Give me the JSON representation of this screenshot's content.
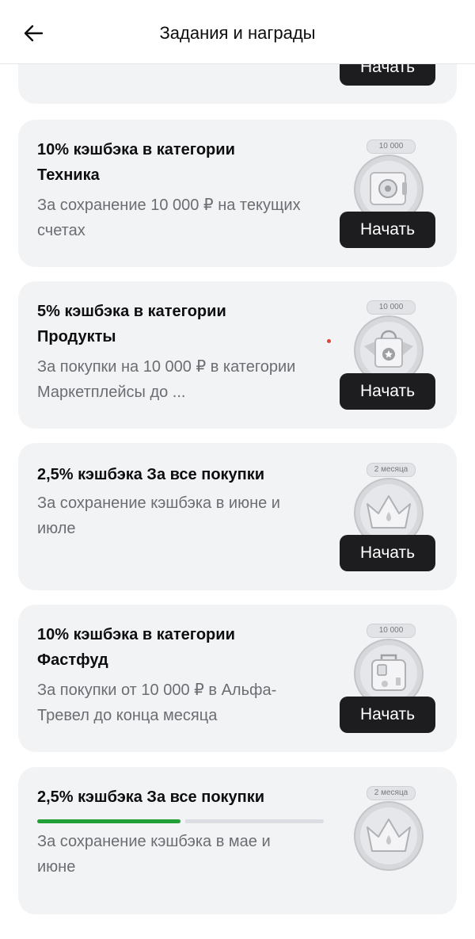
{
  "header": {
    "title": "Задания и награды",
    "back_icon": "arrow-left-icon"
  },
  "colors": {
    "card_bg": "#f2f3f5",
    "button_bg": "#1d1d20",
    "progress_fill": "#21a038",
    "progress_track": "#dcdde3",
    "secondary_text": "#6b6d72"
  },
  "top_partial_card": {
    "button_label": "Начать"
  },
  "tasks": [
    {
      "title": "10% кэшбэка в категории Техника",
      "description": "За сохранение 10 000 ₽ на текущих счетах",
      "badge": "10 000",
      "medal_icon": "safe-icon",
      "button_label": "Начать"
    },
    {
      "title": "5% кэшбэка в категории Продукты",
      "description": "За покупки на 10 000 ₽ в категории Маркетплейсы до ...",
      "badge": "10 000",
      "medal_icon": "shopping-bag-icon",
      "button_label": "Начать"
    },
    {
      "title": "2,5% кэшбэка За все покупки",
      "description": "За сохранение кэшбэка в июне и июле",
      "badge": "2 месяца",
      "medal_icon": "crown-icon",
      "button_label": "Начать"
    },
    {
      "title": "10% кэшбэка в категории Фастфуд",
      "description": "За покупки от 10 000 ₽ в Альфа-Тревел до конца месяца",
      "badge": "10 000",
      "medal_icon": "suitcase-icon",
      "button_label": "Начать"
    },
    {
      "title": "2,5% кэшбэка За все покупки",
      "description": "За сохранение кэшбэка в мае и июне",
      "badge": "2 месяца",
      "medal_icon": "crown-icon",
      "progress": 0.5
    }
  ]
}
